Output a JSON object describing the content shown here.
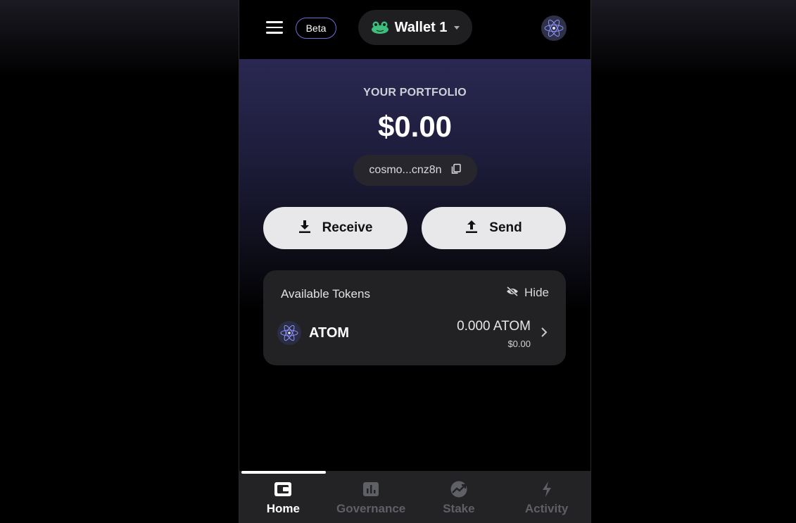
{
  "header": {
    "beta_label": "Beta",
    "wallet_name": "Wallet 1",
    "wallet_icon": "frog-icon",
    "avatar_icon": "cosmos-atom-icon"
  },
  "portfolio": {
    "label": "YOUR PORTFOLIO",
    "value": "$0.00",
    "address": "cosmo...cnz8n"
  },
  "actions": {
    "receive_label": "Receive",
    "send_label": "Send"
  },
  "tokens": {
    "title": "Available Tokens",
    "hide_label": "Hide",
    "items": [
      {
        "symbol": "ATOM",
        "amount": "0.000 ATOM",
        "usd": "$0.00",
        "icon": "cosmos-atom-icon"
      }
    ]
  },
  "nav": {
    "items": [
      {
        "label": "Home",
        "icon": "wallet-icon",
        "active": true
      },
      {
        "label": "Governance",
        "icon": "bar-chart-icon",
        "active": false
      },
      {
        "label": "Stake",
        "icon": "chart-up-icon",
        "active": false
      },
      {
        "label": "Activity",
        "icon": "lightning-icon",
        "active": false
      }
    ]
  },
  "colors": {
    "accent_border": "#6f6fd8",
    "button_bg": "#e8e8ea",
    "card_bg": "#222224",
    "nav_bg": "#232325",
    "frog_green": "#3fbf7f"
  }
}
